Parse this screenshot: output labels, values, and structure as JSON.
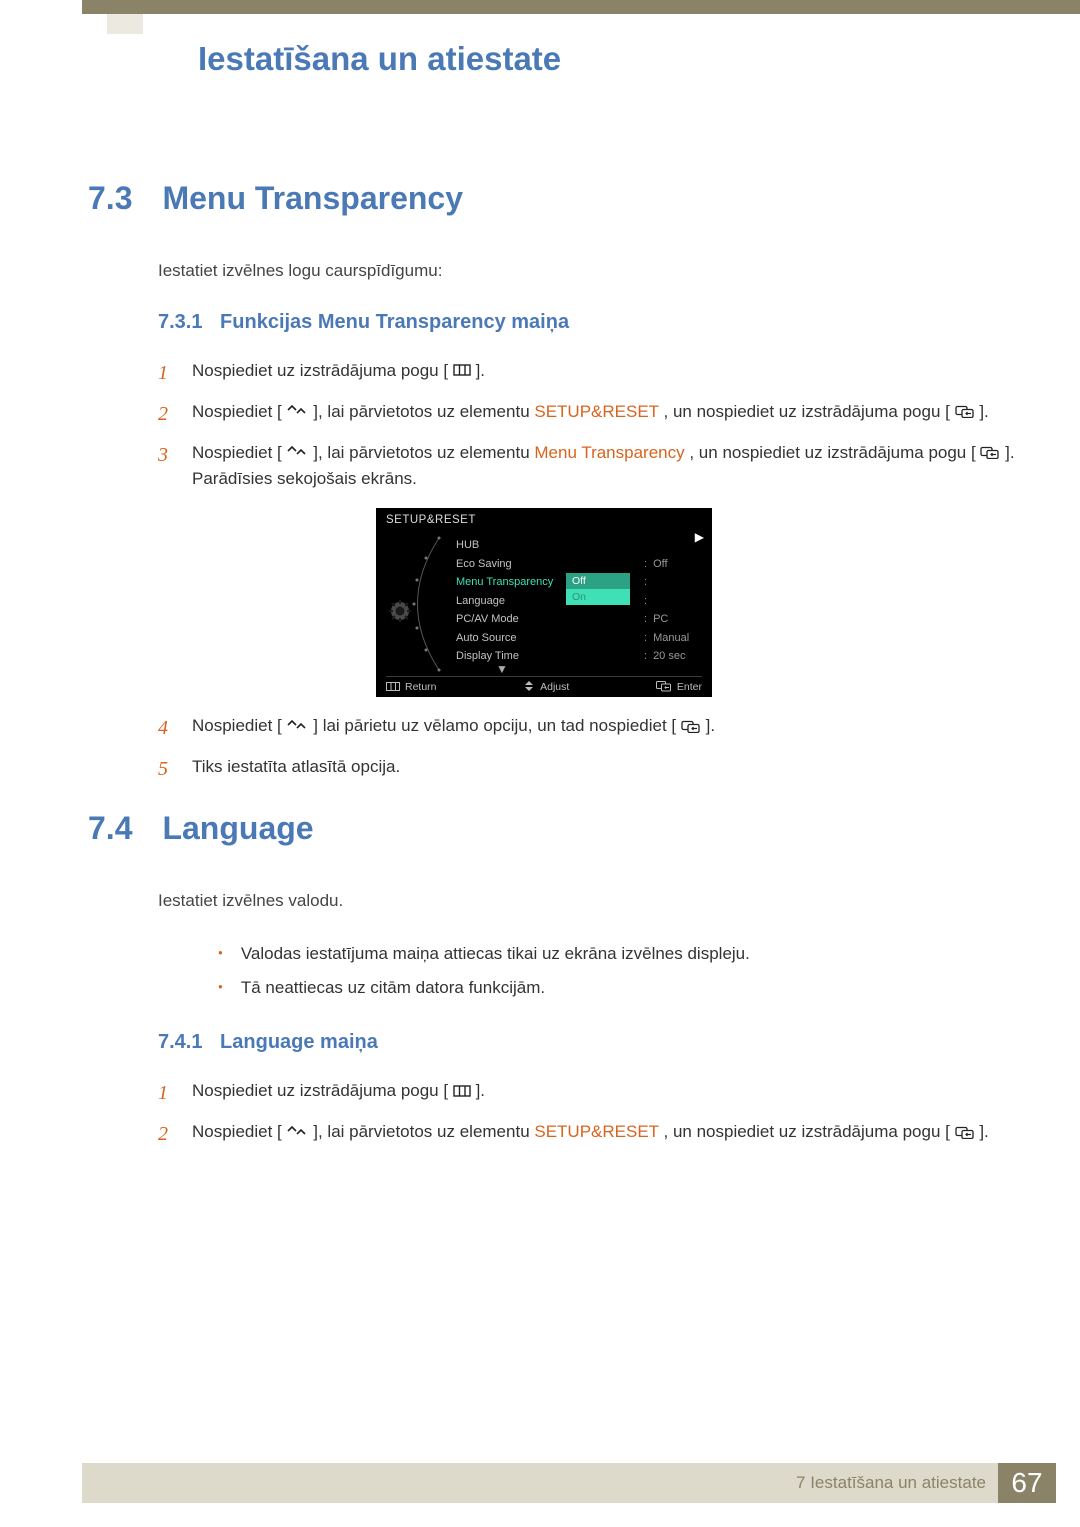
{
  "chapter": {
    "title": "Iestatīšana un atiestate"
  },
  "section73": {
    "num": "7.3",
    "title": "Menu Transparency",
    "desc": "Iestatiet izvēlnes logu caurspīdīgumu:",
    "sub": {
      "num": "7.3.1",
      "title": "Funkcijas Menu Transparency maiņa"
    },
    "steps": {
      "s1": {
        "n": "1",
        "a": "Nospiediet uz izstrādājuma pogu [",
        "b": "]."
      },
      "s2": {
        "n": "2",
        "a": "Nospiediet [",
        "b": "], lai pārvietotos uz elementu ",
        "hl": "SETUP&RESET",
        "c": ", un nospiediet uz izstrādājuma pogu [",
        "d": "]."
      },
      "s3": {
        "n": "3",
        "a": "Nospiediet [",
        "b": "], lai pārvietotos uz elementu ",
        "hl": "Menu Transparency",
        "c": ", un nospiediet uz izstrādājuma pogu [",
        "d": "]. Parādīsies sekojošais ekrāns."
      },
      "s4": {
        "n": "4",
        "a": "Nospiediet [",
        "b": "] lai pārietu uz vēlamo opciju, un tad nospiediet [",
        "c": "]."
      },
      "s5": {
        "n": "5",
        "a": "Tiks iestatīta atlasītā opcija."
      }
    }
  },
  "osd": {
    "title": "SETUP&RESET",
    "items": {
      "hub": {
        "label": "HUB",
        "value": ""
      },
      "eco": {
        "label": "Eco Saving",
        "value": "Off"
      },
      "mt": {
        "label": "Menu Transparency",
        "sel_off": "Off",
        "sel_on": "On"
      },
      "lang": {
        "label": "Language",
        "value": ""
      },
      "pcav": {
        "label": "PC/AV Mode",
        "value": "PC"
      },
      "auto": {
        "label": "Auto Source",
        "value": "Manual"
      },
      "disp": {
        "label": "Display Time",
        "value": "20 sec"
      }
    },
    "footer": {
      "return": "Return",
      "adjust": "Adjust",
      "enter": "Enter"
    }
  },
  "section74": {
    "num": "7.4",
    "title": "Language",
    "desc": "Iestatiet izvēlnes valodu.",
    "bullets": {
      "b1": "Valodas iestatījuma maiņa attiecas tikai uz ekrāna izvēlnes displeju.",
      "b2": "Tā neattiecas uz citām datora funkcijām."
    },
    "sub": {
      "num": "7.4.1",
      "title": "Language maiņa"
    },
    "steps": {
      "s1": {
        "n": "1",
        "a": "Nospiediet uz izstrādājuma pogu [",
        "b": "]."
      },
      "s2": {
        "n": "2",
        "a": "Nospiediet [",
        "b": "], lai pārvietotos uz elementu ",
        "hl": "SETUP&RESET",
        "c": ", un nospiediet uz izstrādājuma pogu [",
        "d": "]."
      }
    }
  },
  "footer": {
    "chapter": "7 Iestatīšana un atiestate",
    "page": "67"
  }
}
